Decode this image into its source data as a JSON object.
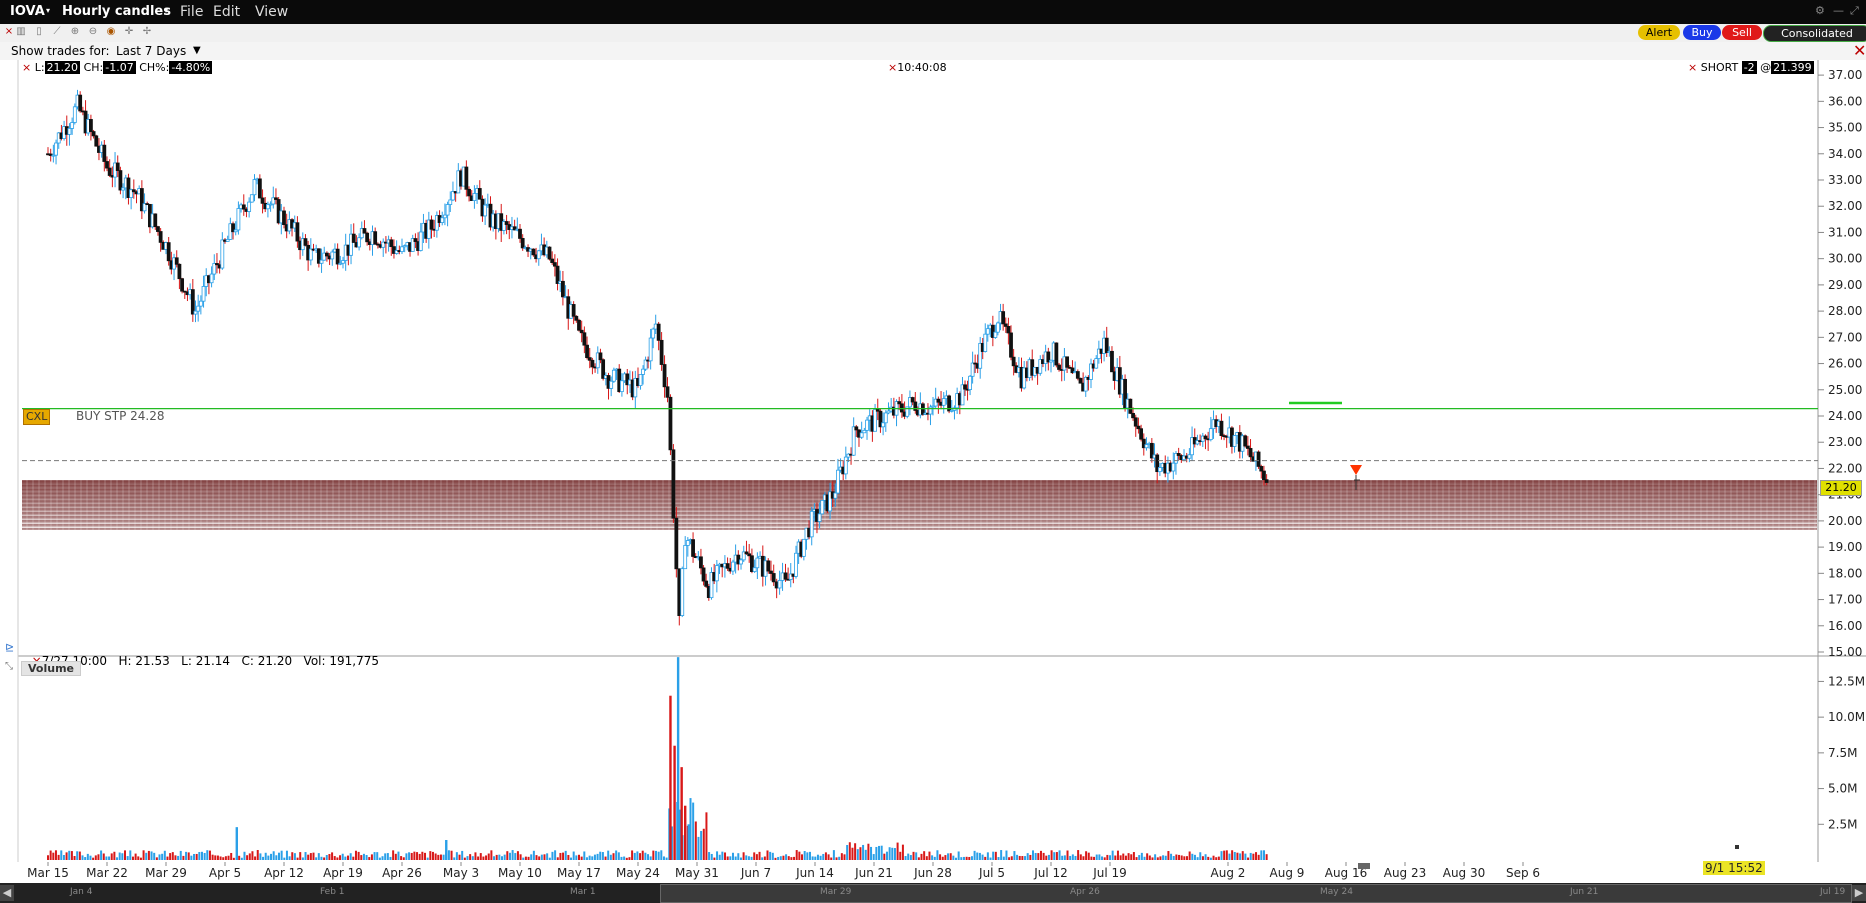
{
  "window": {
    "symbol": "IOVA",
    "mode": "Hourly candles",
    "menus": [
      "File",
      "Edit",
      "View"
    ]
  },
  "trades_filter": {
    "label": "Show trades for:",
    "value": "Last 7 Days"
  },
  "order_buttons": {
    "alert": "Alert",
    "buy": "Buy",
    "sell": "Sell",
    "consolidated": "Consolidated"
  },
  "quote": {
    "last_label": "L:",
    "last": "21.20",
    "change_label": "CH:",
    "change": "-1.07",
    "change_pct_label": "CH%:",
    "change_pct": "-4.80%"
  },
  "clock": "10:40:08",
  "position": {
    "side": "SHORT",
    "qty": "-2",
    "at": "@",
    "avg_price": "21.399"
  },
  "order_line": {
    "cancel": "CXL",
    "label": "BUY STP 24.28",
    "price": 24.28
  },
  "last_price_tag": "21.20",
  "hover_readout": "7/27 10:00   H: 21.53   L: 21.14   C: 21.20   Vol: 191,775",
  "volume_panel_title": "Volume",
  "scroll_readout": "9/1 15:52",
  "scroll_dates": [
    "Jan 4",
    "Feb 1",
    "Mar 1",
    "Mar 29",
    "Apr 26",
    "May 24",
    "Jun 21",
    "Jul 19"
  ],
  "colors": {
    "up": "#2aa0e8",
    "down": "#d81818",
    "order_line": "#22bb22",
    "band": "#8a4a4a",
    "price_tag": "#d8d800"
  },
  "chart_data": {
    "type": "candlestick",
    "title": "IOVA Hourly candles",
    "ylim": [
      15,
      37.5
    ],
    "yticks": [
      "37.00",
      "36.00",
      "35.00",
      "34.00",
      "33.00",
      "32.00",
      "31.00",
      "30.00",
      "29.00",
      "28.00",
      "27.00",
      "26.00",
      "25.00",
      "24.00",
      "23.00",
      "22.00",
      "21.00",
      "20.00",
      "19.00",
      "18.00",
      "17.00",
      "16.00",
      "15.00"
    ],
    "xticks": [
      "Mar 15",
      "Mar 22",
      "Mar 29",
      "Apr 5",
      "Apr 12",
      "Apr 19",
      "Apr 26",
      "May 3",
      "May 10",
      "May 17",
      "May 24",
      "May 31",
      "Jun 7",
      "Jun 14",
      "Jun 21",
      "Jun 28",
      "Jul 5",
      "Jul 12",
      "Jul 19",
      "Aug 2",
      "Aug 9",
      "Aug 16",
      "Aug 23",
      "Aug 30",
      "Sep 6"
    ],
    "price_path": [
      [
        0,
        34.0
      ],
      [
        0.5,
        35.8
      ],
      [
        1.0,
        33.5
      ],
      [
        1.5,
        32.5
      ],
      [
        2.0,
        30.5
      ],
      [
        2.5,
        28.0
      ],
      [
        3.0,
        30.5
      ],
      [
        3.5,
        32.8
      ],
      [
        4.0,
        31.5
      ],
      [
        4.5,
        30.0
      ],
      [
        5.0,
        30.3
      ],
      [
        5.5,
        31.0
      ],
      [
        6.0,
        30.2
      ],
      [
        6.5,
        31.2
      ],
      [
        7.0,
        33.2
      ],
      [
        7.5,
        31.5
      ],
      [
        8.0,
        30.8
      ],
      [
        8.5,
        30.0
      ],
      [
        9.0,
        27.0
      ],
      [
        9.5,
        25.5
      ],
      [
        10.0,
        25.0
      ],
      [
        10.3,
        27.5
      ],
      [
        10.5,
        24.8
      ],
      [
        10.7,
        16.0
      ],
      [
        10.8,
        19.5
      ],
      [
        11.2,
        17.5
      ],
      [
        11.7,
        18.8
      ],
      [
        12.3,
        18.0
      ],
      [
        12.5,
        17.5
      ],
      [
        12.9,
        19.8
      ],
      [
        13.3,
        21.0
      ],
      [
        13.7,
        23.5
      ],
      [
        14.2,
        24.0
      ],
      [
        14.7,
        24.5
      ],
      [
        15.0,
        24.3
      ],
      [
        15.5,
        24.8
      ],
      [
        15.8,
        26.5
      ],
      [
        16.1,
        27.8
      ],
      [
        16.5,
        25.5
      ],
      [
        17.0,
        26.5
      ],
      [
        17.5,
        25.0
      ],
      [
        17.9,
        26.8
      ],
      [
        18.3,
        24.5
      ],
      [
        18.8,
        22.0
      ],
      [
        19.3,
        22.5
      ],
      [
        19.8,
        23.8
      ],
      [
        20.2,
        23.0
      ],
      [
        20.7,
        21.5
      ]
    ],
    "volume": {
      "yticks": [
        "12.5M",
        "10.0M",
        "7.5M",
        "5.0M",
        "2.5M"
      ],
      "ylim": [
        0,
        14000000
      ],
      "spikes": [
        {
          "x": 10.55,
          "value": 11500000,
          "dir": "down"
        },
        {
          "x": 10.62,
          "value": 8000000,
          "dir": "down"
        },
        {
          "x": 10.68,
          "value": 14200000,
          "dir": "up"
        },
        {
          "x": 10.74,
          "value": 6500000,
          "dir": "down"
        },
        {
          "x": 10.8,
          "value": 3800000,
          "dir": "down"
        },
        {
          "x": 10.86,
          "value": 2500000,
          "dir": "up"
        },
        {
          "x": 3.2,
          "value": 2300000,
          "dir": "up"
        },
        {
          "x": 6.75,
          "value": 1400000,
          "dir": "up"
        }
      ]
    }
  }
}
